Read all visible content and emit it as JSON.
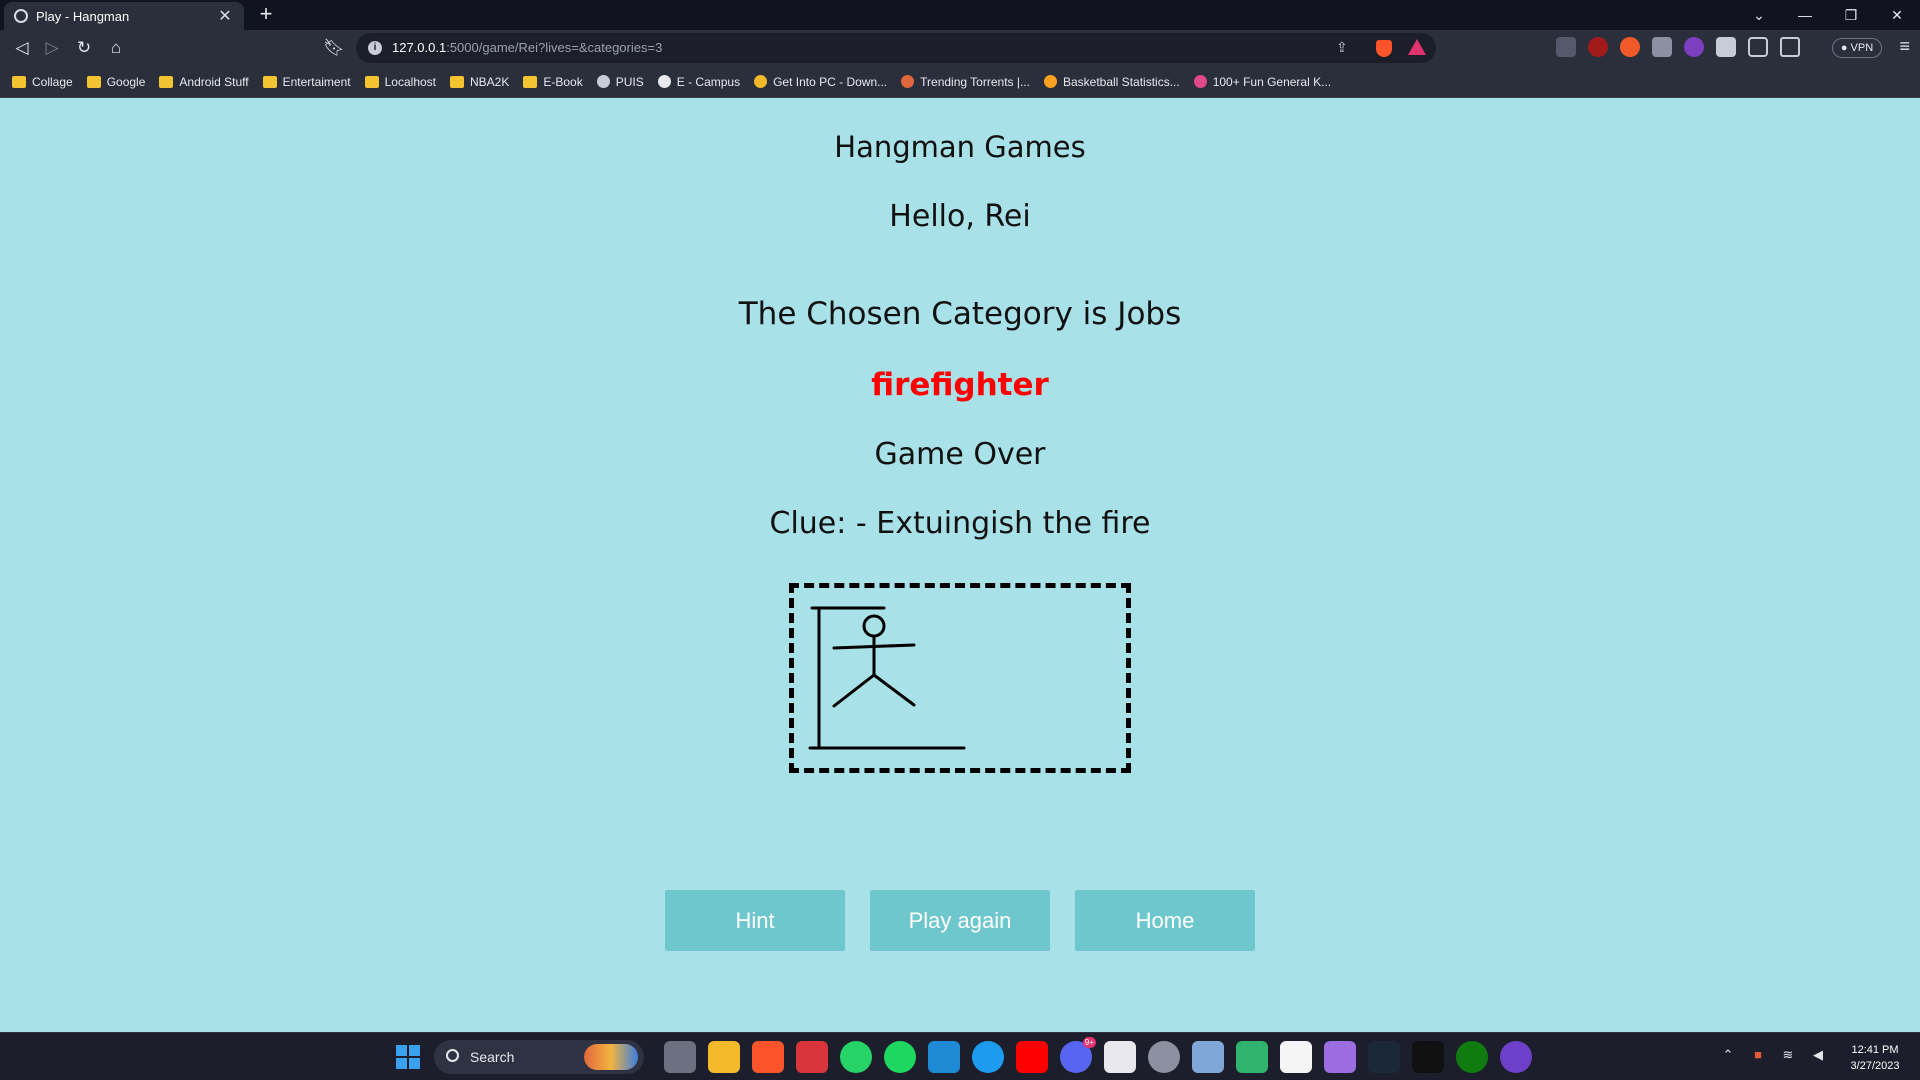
{
  "browser": {
    "tab_title": "Play - Hangman",
    "url_host": "127.0.0.1",
    "url_path": ":5000/game/Rei?lives=&categories=3",
    "vpn_label": "VPN",
    "bookmarks": [
      {
        "label": "Collage",
        "icon": "folder-icon"
      },
      {
        "label": "Google",
        "icon": "folder-icon"
      },
      {
        "label": "Android Stuff",
        "icon": "folder-icon"
      },
      {
        "label": "Entertaiment",
        "icon": "folder-icon"
      },
      {
        "label": "Localhost",
        "icon": "folder-icon"
      },
      {
        "label": "NBA2K",
        "icon": "folder-icon"
      },
      {
        "label": "E-Book",
        "icon": "folder-icon"
      },
      {
        "label": "PUIS",
        "icon": "site-icon"
      },
      {
        "label": "E - Campus",
        "icon": "site-icon"
      },
      {
        "label": "Get Into PC - Down...",
        "icon": "site-icon"
      },
      {
        "label": "Trending Torrents |...",
        "icon": "site-icon"
      },
      {
        "label": "Basketball Statistics...",
        "icon": "site-icon"
      },
      {
        "label": "100+ Fun General K...",
        "icon": "site-icon"
      }
    ]
  },
  "game": {
    "title": "Hangman Games",
    "greeting": "Hello, Rei",
    "category_text": "The Chosen Category is Jobs",
    "answer": "firefighter",
    "answer_color": "#ff0000",
    "status": "Game Over",
    "clue": "Clue: - Extuingish the fire",
    "buttons": {
      "hint": "Hint",
      "play_again": "Play again",
      "home": "Home"
    }
  },
  "taskbar": {
    "search_label": "Search",
    "time": "12:41 PM",
    "date": "3/27/2023",
    "discord_badge": "9+"
  }
}
